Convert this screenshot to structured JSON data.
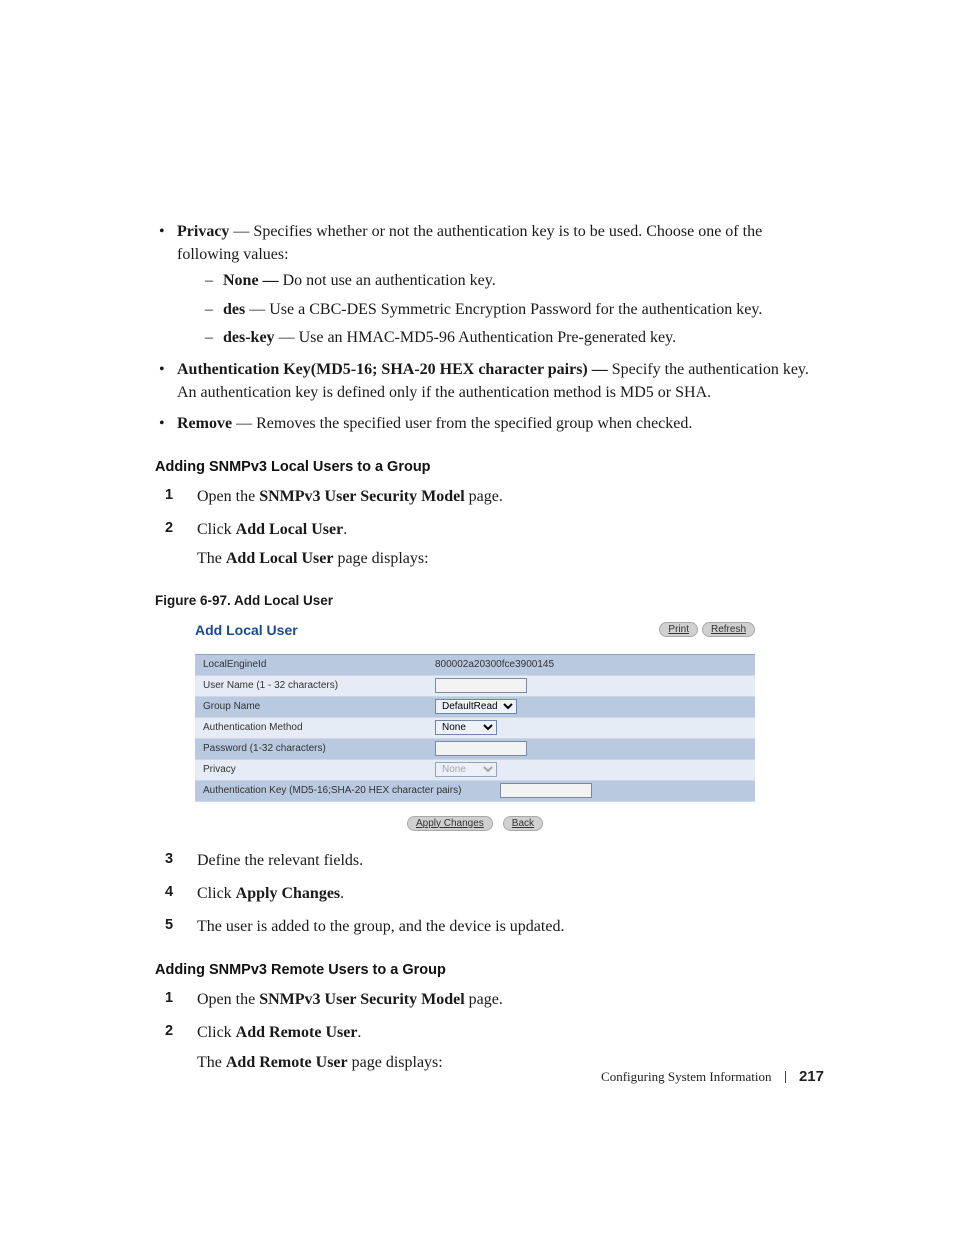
{
  "bullets": {
    "privacy": {
      "label": "Privacy",
      "desc": " — Specifies whether or not the authentication key is to be used. Choose one of the following values:",
      "items": [
        {
          "label": "None — ",
          "desc": "Do not use an authentication key."
        },
        {
          "label": "des",
          "desc": " — Use a CBC-DES Symmetric Encryption Password for the authentication key."
        },
        {
          "label": "des-key",
          "desc": " — Use an HMAC-MD5-96 Authentication Pre-generated key."
        }
      ]
    },
    "authkey": {
      "label": "Authentication Key(MD5-16; SHA-20 HEX character pairs) — ",
      "desc": "Specify the authentication key. An authentication key is defined only if the authentication method is MD5 or SHA."
    },
    "remove": {
      "label": "Remove",
      "desc": " — Removes the specified user from the specified group when checked."
    }
  },
  "sectLocal": {
    "heading": "Adding SNMPv3 Local Users to a Group",
    "steps": [
      {
        "n": "1",
        "pre": "Open the ",
        "bold": "SNMPv3 User Security Model",
        "post": " page."
      },
      {
        "n": "2",
        "pre": "Click ",
        "bold": "Add Local User",
        "post": ".",
        "sub_pre": "The ",
        "sub_bold": "Add Local User",
        "sub_post": " page displays:"
      }
    ],
    "figcap": "Figure 6-97.    Add Local User"
  },
  "shot": {
    "title": "Add Local User",
    "print": "Print",
    "refresh": "Refresh",
    "rows": {
      "localengine_l": "LocalEngineId",
      "localengine_v": "800002a20300fce3900145",
      "username_l": "User Name (1 - 32 characters)",
      "group_l": "Group Name",
      "group_v": "DefaultRead",
      "auth_l": "Authentication Method",
      "auth_v": "None",
      "pwd_l": "Password (1-32 characters)",
      "priv_l": "Privacy",
      "priv_v": "None",
      "akey_l": "Authentication Key (MD5-16;SHA-20 HEX character pairs)"
    },
    "apply": "Apply Changes",
    "back": "Back"
  },
  "stepsAfter": [
    {
      "n": "3",
      "text": "Define the relevant fields."
    },
    {
      "n": "4",
      "pre": "Click ",
      "bold": "Apply Changes",
      "post": "."
    },
    {
      "n": "5",
      "text": "The user is added to the group, and the device is updated."
    }
  ],
  "sectRemote": {
    "heading": "Adding SNMPv3 Remote Users to a Group",
    "steps": [
      {
        "n": "1",
        "pre": "Open the ",
        "bold": "SNMPv3 User Security Model",
        "post": " page."
      },
      {
        "n": "2",
        "pre": "Click ",
        "bold": "Add Remote User",
        "post": ".",
        "sub_pre": "The ",
        "sub_bold": "Add Remote User",
        "sub_post": " page displays:"
      }
    ]
  },
  "footer": {
    "section": "Configuring System Information",
    "page": "217"
  }
}
